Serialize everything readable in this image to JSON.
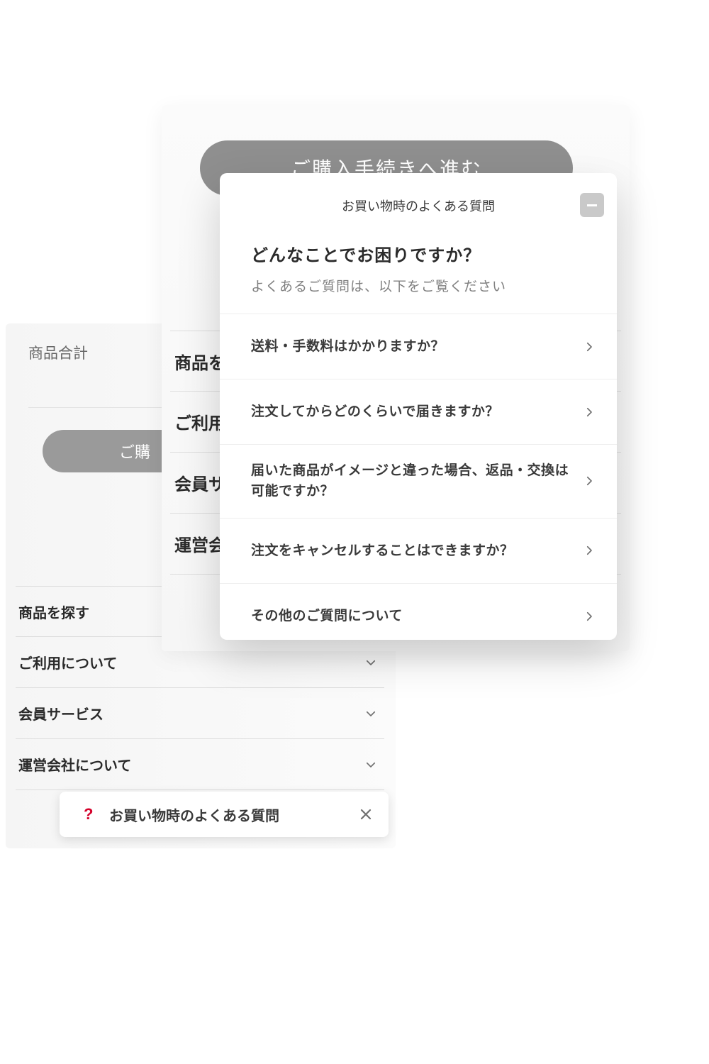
{
  "back_panel": {
    "total_label": "商品合計",
    "checkout_partial": "ご購",
    "menu": [
      "商品を探す",
      "ご利用について",
      "会員サービス",
      "運営会社について"
    ]
  },
  "mid_panel": {
    "primary_button": "ご購入手続きへ進む",
    "menu": [
      "商品を",
      "ご利用",
      "会員サ",
      "運営会"
    ]
  },
  "popup": {
    "bar_title": "お買い物時のよくある質問",
    "heading": "どんなことでお困りですか？",
    "subheading": "よくあるご質問は、以下をご覧ください",
    "questions": [
      "送料・手数料はかかりますか？",
      "注文してからどのくらいで届きますか？",
      "届いた商品がイメージと違った場合、返品・交換は可能ですか？",
      "注文をキャンセルすることはできますか？",
      "その他のご質問について"
    ]
  },
  "chip": {
    "label": "お買い物時のよくある質問"
  }
}
